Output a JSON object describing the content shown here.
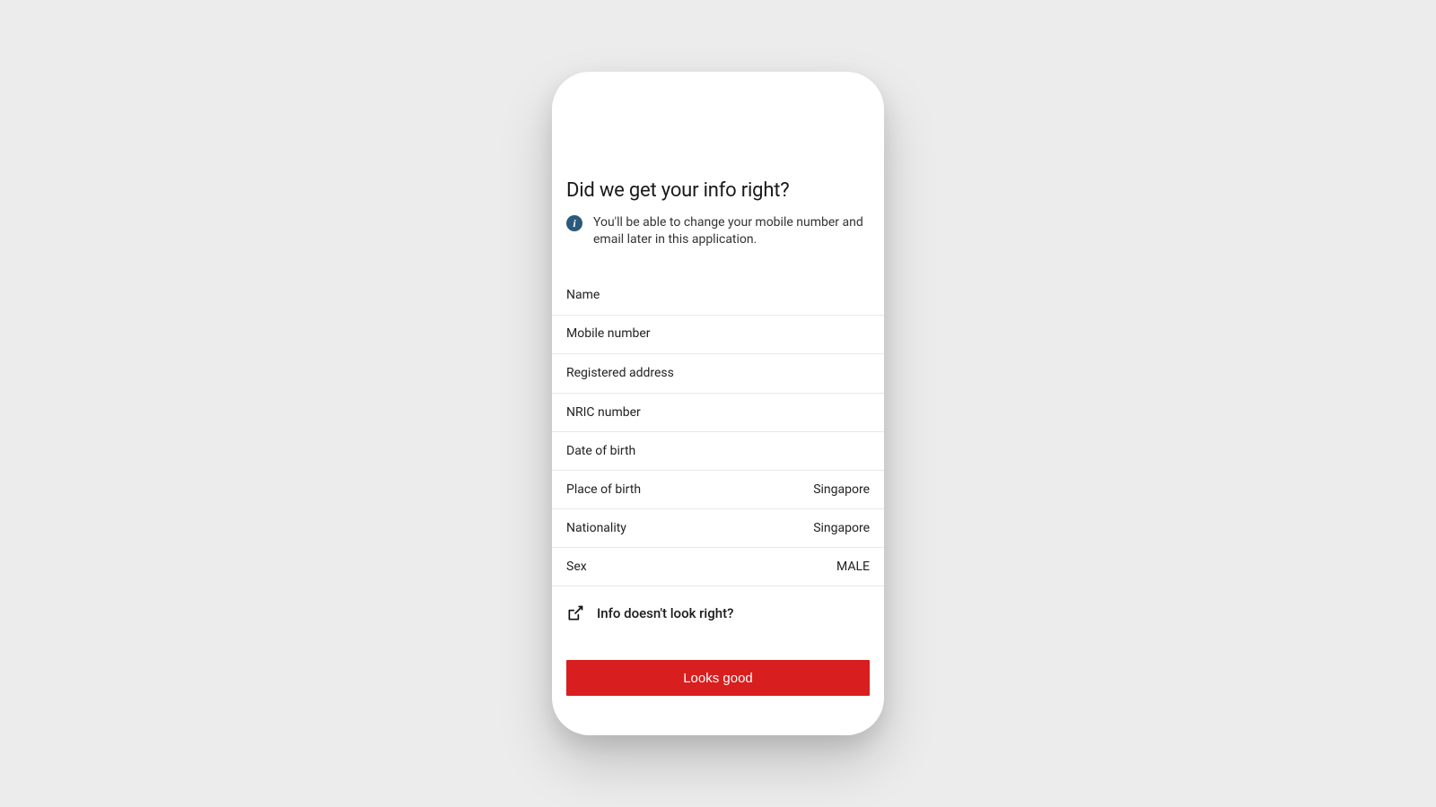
{
  "header": {
    "title": "Did we get your info right?",
    "notice": "You'll be able to change your mobile number and email later in this application."
  },
  "fields": {
    "name": {
      "label": "Name",
      "value": ""
    },
    "mobile": {
      "label": "Mobile number",
      "value": ""
    },
    "address": {
      "label": "Registered address",
      "value": ""
    },
    "nric": {
      "label": "NRIC number",
      "value": ""
    },
    "dob": {
      "label": "Date of birth",
      "value": ""
    },
    "pob": {
      "label": "Place of birth",
      "value": "Singapore"
    },
    "nationality": {
      "label": "Nationality",
      "value": "Singapore"
    },
    "sex": {
      "label": "Sex",
      "value": "MALE"
    }
  },
  "help": {
    "label": "Info doesn't look right?"
  },
  "actions": {
    "primary": "Looks good"
  }
}
